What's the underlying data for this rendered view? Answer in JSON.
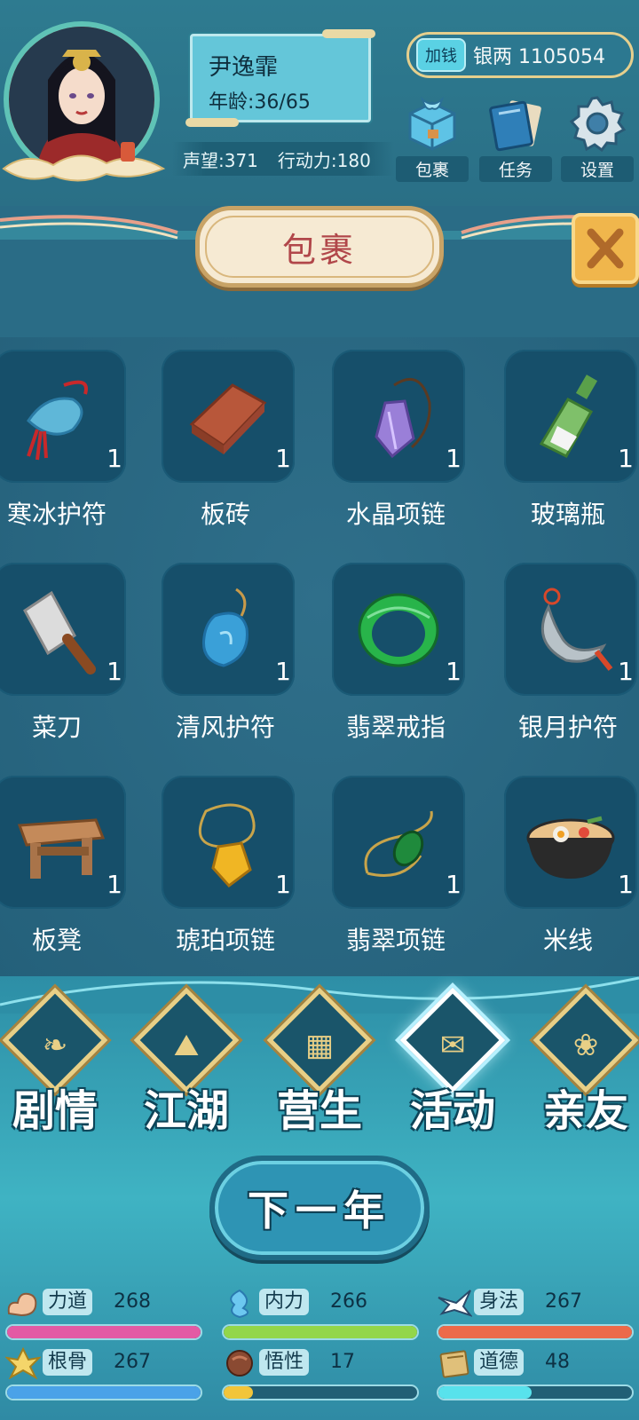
{
  "player": {
    "name": "尹逸霏",
    "age": "年龄:36/65",
    "reputation": "声望:371",
    "action_points": "行动力:180"
  },
  "currency": {
    "add_label": "加钱",
    "silver": "银两 1105054"
  },
  "top_buttons": [
    {
      "label": "包裹",
      "icon": "bundle-icon"
    },
    {
      "label": "任务",
      "icon": "task-book-icon"
    },
    {
      "label": "设置",
      "icon": "gear-icon"
    }
  ],
  "panel": {
    "title": "包裹",
    "close_icon": "close-x-icon"
  },
  "inventory": {
    "items": [
      {
        "name": "寒冰护符",
        "count": "1",
        "icon": "ice-charm-icon",
        "color": "#5fb7d8"
      },
      {
        "name": "板砖",
        "count": "1",
        "icon": "brick-icon",
        "color": "#b8573a"
      },
      {
        "name": "水晶项链",
        "count": "1",
        "icon": "crystal-necklace-icon",
        "color": "#9a7fd8"
      },
      {
        "name": "玻璃瓶",
        "count": "1",
        "icon": "glass-bottle-icon",
        "color": "#7fc06a"
      },
      {
        "name": "菜刀",
        "count": "1",
        "icon": "cleaver-icon",
        "color": "#d9d9d9"
      },
      {
        "name": "清风护符",
        "count": "1",
        "icon": "wind-charm-icon",
        "color": "#3aa0d8"
      },
      {
        "name": "翡翠戒指",
        "count": "1",
        "icon": "jade-ring-icon",
        "color": "#28b44a"
      },
      {
        "name": "银月护符",
        "count": "1",
        "icon": "silver-moon-charm-icon",
        "color": "#b8c2c8"
      },
      {
        "name": "板凳",
        "count": "1",
        "icon": "bench-icon",
        "color": "#a9744a"
      },
      {
        "name": "琥珀项链",
        "count": "1",
        "icon": "amber-necklace-icon",
        "color": "#f0b624"
      },
      {
        "name": "翡翠项链",
        "count": "1",
        "icon": "jade-necklace-icon",
        "color": "#1f8a3c"
      },
      {
        "name": "米线",
        "count": "1",
        "icon": "rice-noodles-icon",
        "color": "#e9c28a"
      }
    ]
  },
  "nav": [
    {
      "label": "剧情",
      "icon": "story-icon",
      "glyph": "❧",
      "active": false
    },
    {
      "label": "江湖",
      "icon": "jianghu-icon",
      "glyph": "⛰",
      "active": false
    },
    {
      "label": "营生",
      "icon": "abacus-icon",
      "glyph": "▦",
      "active": false
    },
    {
      "label": "活动",
      "icon": "activity-scroll-icon",
      "glyph": "✉",
      "active": true
    },
    {
      "label": "亲友",
      "icon": "friends-icon",
      "glyph": "❀",
      "active": false
    }
  ],
  "next_year_label": "下一年",
  "attributes": [
    {
      "label": "力道",
      "value": "268",
      "icon": "strength-arm-icon",
      "fill": 1.0,
      "color": "#e35aa4"
    },
    {
      "label": "内力",
      "value": "266",
      "icon": "inner-energy-icon",
      "fill": 1.0,
      "color": "#93d64a"
    },
    {
      "label": "身法",
      "value": "267",
      "icon": "swallow-icon",
      "fill": 1.0,
      "color": "#ec6a4a"
    },
    {
      "label": "根骨",
      "value": "267",
      "icon": "bone-aura-icon",
      "fill": 1.0,
      "color": "#4aa2e8"
    },
    {
      "label": "悟性",
      "value": "17",
      "icon": "insight-head-icon",
      "fill": 0.15,
      "color": "#f2c53a"
    },
    {
      "label": "道德",
      "value": "48",
      "icon": "morality-book-icon",
      "fill": 0.48,
      "color": "#58e2ec"
    }
  ]
}
